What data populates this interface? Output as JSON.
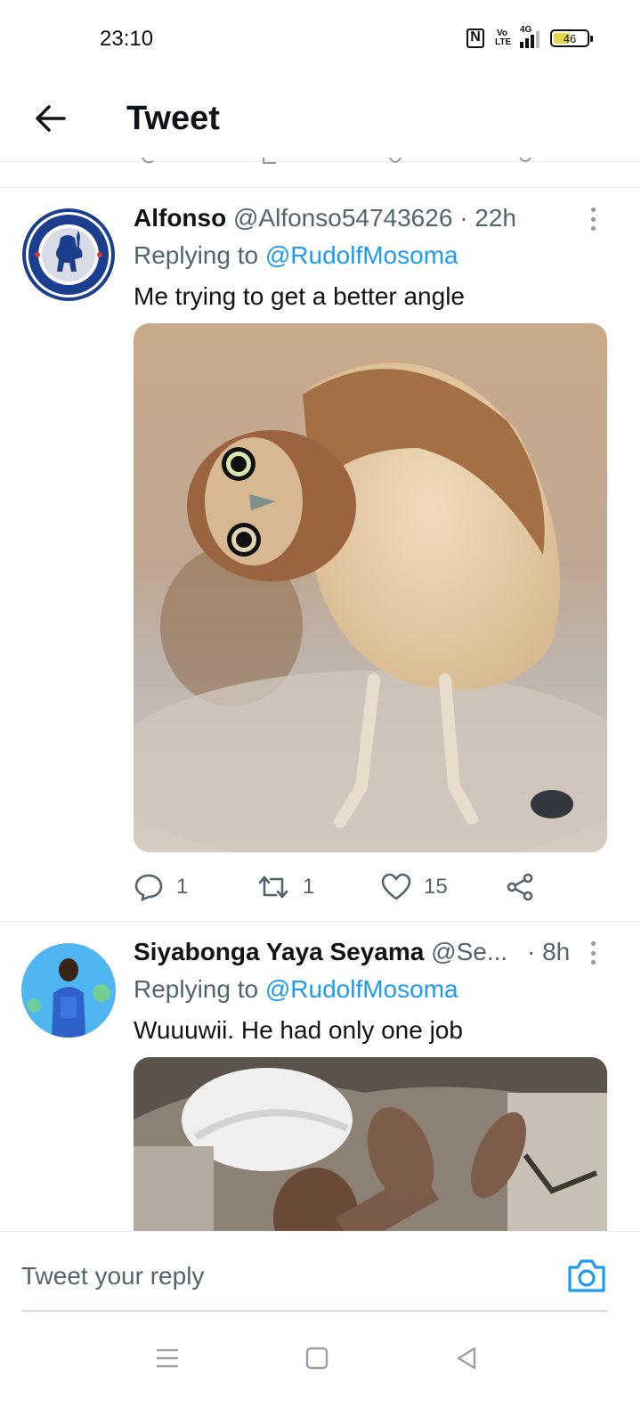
{
  "status_bar": {
    "time": "23:10",
    "volte_label": "Vo LTE",
    "network_label": "4G",
    "battery_level": "46"
  },
  "header": {
    "title": "Tweet"
  },
  "tweets": [
    {
      "name": "Alfonso",
      "handle": "@Alfonso54743626",
      "time": "· 22h",
      "replying_prefix": "Replying to",
      "replying_to": "@RudolfMosoma",
      "text": "Me trying to get a better angle",
      "avatar_icon": "chelsea-fc-crest",
      "media_description_icon": "owl-photo",
      "stats": {
        "replies": "1",
        "retweets": "1",
        "likes": "15"
      }
    },
    {
      "name": "Siyabonga Yaya Seyama",
      "handle": "@Se...",
      "time": "· 8h",
      "replying_prefix": "Replying to",
      "replying_to": "@RudolfMosoma",
      "text": "Wuuuwii. He had only one job",
      "avatar_icon": "user-photo",
      "media_description_icon": "video-thumbnail"
    }
  ],
  "reply_bar": {
    "placeholder": "Tweet your reply",
    "camera_icon": "camera-icon"
  },
  "nav": {
    "menu_icon": "menu-icon",
    "home_icon": "home-square-icon",
    "back_icon": "back-triangle-icon"
  },
  "colors": {
    "accent": "#1d9bf0",
    "muted_text": "#536471",
    "primary_text": "#0f1419",
    "divider": "#e6ecf0"
  }
}
